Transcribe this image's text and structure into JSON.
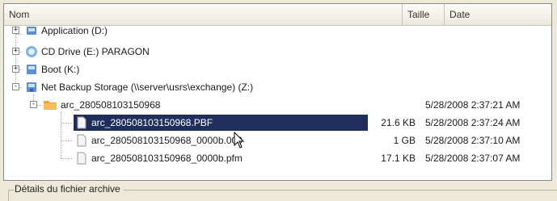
{
  "columns": {
    "name": "Nom",
    "size": "Taille",
    "date": "Date"
  },
  "tree": [
    {
      "label": "Application (D:)",
      "icon": "drive-icon",
      "expander": "+"
    },
    {
      "label": "CD Drive (E:) PARAGON",
      "icon": "cd-drive-icon",
      "expander": "+"
    },
    {
      "label": "Boot (K:)",
      "icon": "drive-icon",
      "expander": "+"
    },
    {
      "label": "Net Backup Storage (\\\\server\\usrs\\exchange) (Z:)",
      "icon": "network-drive-icon",
      "expander": "-"
    },
    {
      "label": "arc_280508103150968",
      "icon": "archive-folder-icon",
      "expander": "-",
      "date": "5/28/2008 2:37:21 AM"
    },
    {
      "label": "arc_280508103150968.PBF",
      "icon": "file-icon",
      "size": "21.6 KB",
      "date": "5/28/2008 2:37:24 AM",
      "selected": true
    },
    {
      "label": "arc_280508103150968_0000b.000",
      "icon": "file-icon",
      "size": "1 GB",
      "date": "5/28/2008 2:37:10 AM"
    },
    {
      "label": "arc_280508103150968_0000b.pfm",
      "icon": "file-icon",
      "size": "17.1 KB",
      "date": "5/28/2008 2:37:07 AM"
    }
  ],
  "details_group": {
    "label": "Détails du fichier archive"
  },
  "colors": {
    "selection": "#1f2e5d",
    "archive_folder": "#f2a23a",
    "drive_blue": "#5b8fd6",
    "window_bg": "#ece9d8"
  }
}
